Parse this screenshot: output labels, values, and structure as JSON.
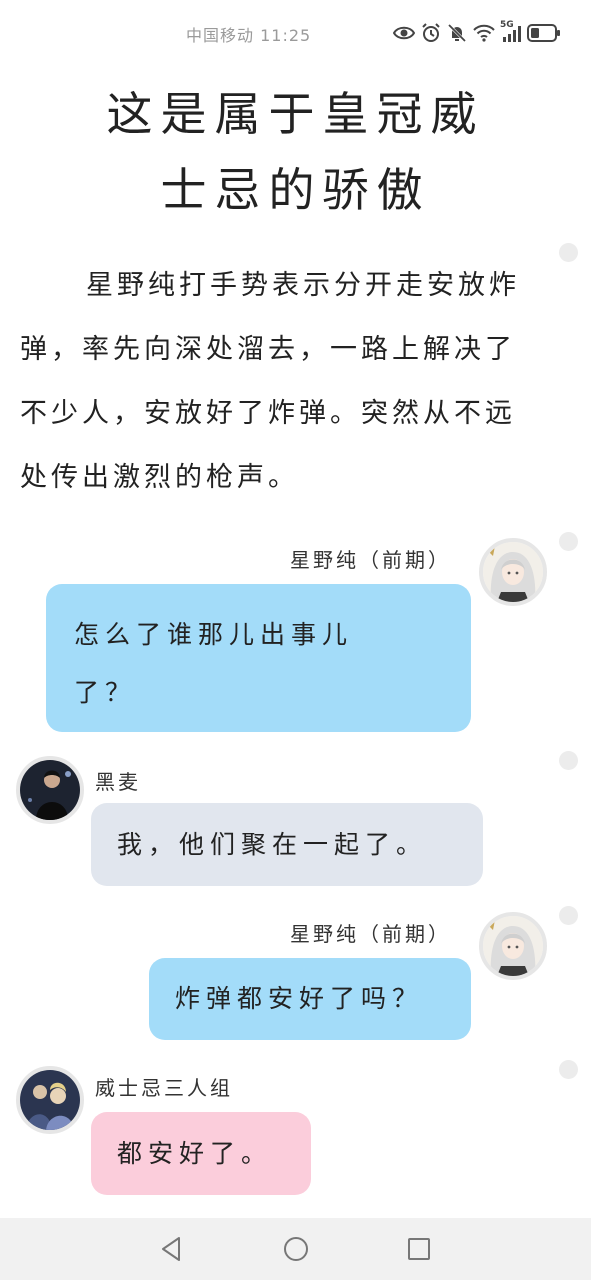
{
  "status_bar": {
    "carrier_time": "中国移动 11:25",
    "network_label": "5G",
    "icons": [
      "eye-icon",
      "alarm-icon",
      "mute-icon",
      "wifi-icon",
      "signal-icon",
      "battery-icon"
    ]
  },
  "title": {
    "line1": "这是属于皇冠威",
    "line2": "士忌的骄傲"
  },
  "story": {
    "paragraph": "星野纯打手势表示分开走安放炸弹，率先向深处溜去，一路上解决了不少人，安放好了炸弹。突然从不远处传出激烈的枪声。"
  },
  "chat": {
    "messages": [
      {
        "sender": "星野纯（前期）",
        "side": "right",
        "color": "blue",
        "lines": [
          "怎么了谁那儿出事儿",
          "了？"
        ]
      },
      {
        "sender": "黑麦",
        "side": "left",
        "color": "grey",
        "lines": [
          "我，他们聚在一起了。"
        ]
      },
      {
        "sender": "星野纯（前期）",
        "side": "right",
        "color": "blue",
        "lines": [
          "炸弹都安好了吗？"
        ]
      },
      {
        "sender": "威士忌三人组",
        "side": "left",
        "color": "pink",
        "lines": [
          "都安好了。"
        ]
      }
    ]
  },
  "colors": {
    "bubble_blue": "#a3dcf9",
    "bubble_grey": "#e1e6ee",
    "bubble_pink": "#fbcddb",
    "nav_bar": "#f1f1f1"
  },
  "nav": {
    "icons": [
      "back-triangle-icon",
      "home-circle-icon",
      "recents-square-icon"
    ]
  }
}
